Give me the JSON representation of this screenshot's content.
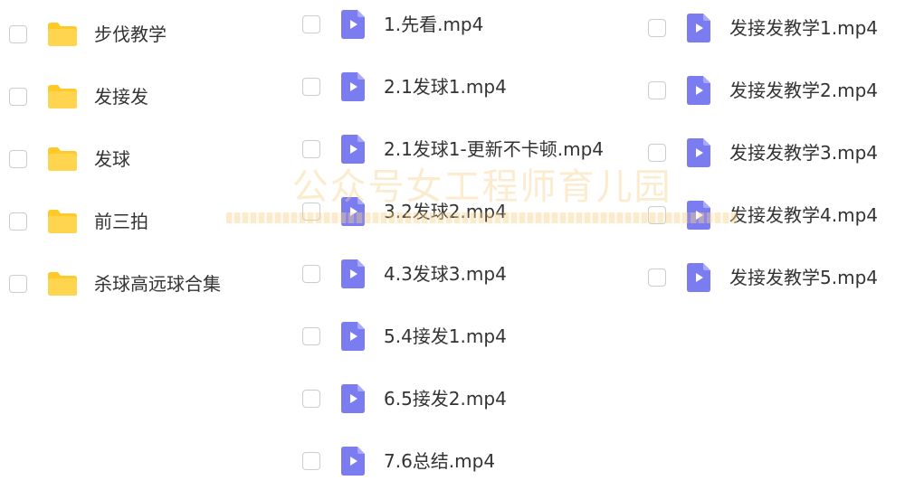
{
  "folders": [
    {
      "name": "步伐教学",
      "icon": "folder-icon"
    },
    {
      "name": "发接发",
      "icon": "folder-icon"
    },
    {
      "name": "发球",
      "icon": "folder-icon"
    },
    {
      "name": "前三拍",
      "icon": "folder-icon"
    },
    {
      "name": "杀球高远球合集",
      "icon": "folder-icon"
    }
  ],
  "files_column_2": [
    {
      "name": "1.先看.mp4",
      "icon": "video-file-icon"
    },
    {
      "name": "2.1发球1.mp4",
      "icon": "video-file-icon"
    },
    {
      "name": "2.1发球1-更新不卡顿.mp4",
      "icon": "video-file-icon"
    },
    {
      "name": "3.2发球2.mp4",
      "icon": "video-file-icon"
    },
    {
      "name": "4.3发球3.mp4",
      "icon": "video-file-icon"
    },
    {
      "name": "5.4接发1.mp4",
      "icon": "video-file-icon"
    },
    {
      "name": "6.5接发2.mp4",
      "icon": "video-file-icon"
    },
    {
      "name": "7.6总结.mp4",
      "icon": "video-file-icon"
    }
  ],
  "files_column_3": [
    {
      "name": "发接发教学1.mp4",
      "icon": "video-file-icon"
    },
    {
      "name": "发接发教学2.mp4",
      "icon": "video-file-icon"
    },
    {
      "name": "发接发教学3.mp4",
      "icon": "video-file-icon"
    },
    {
      "name": "发接发教学4.mp4",
      "icon": "video-file-icon"
    },
    {
      "name": "发接发教学5.mp4",
      "icon": "video-file-icon"
    }
  ],
  "watermark": {
    "text": "公众号女工程师育儿园"
  },
  "colors": {
    "folder": "#FFCA28",
    "video_file": "#7B7CF0",
    "checkbox_border": "#C9CCD1",
    "text": "#333333",
    "watermark": "#F6D28C"
  }
}
